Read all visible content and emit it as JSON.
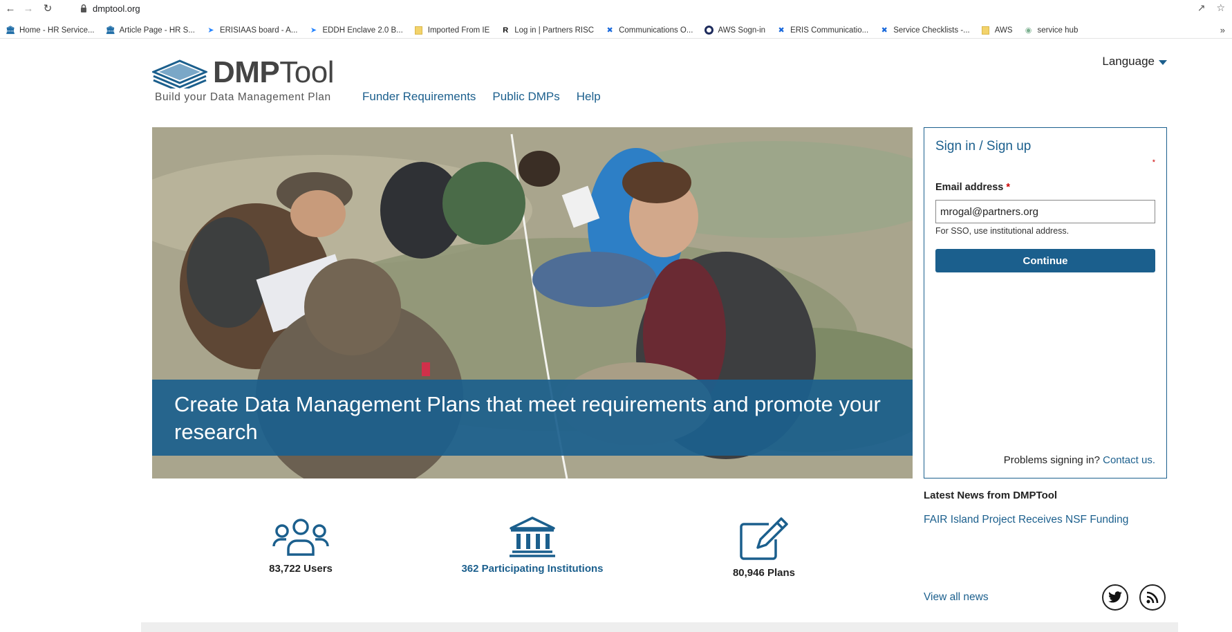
{
  "browser": {
    "url": "dmptool.org",
    "bookmarks": [
      {
        "label": "Home - HR Service...",
        "icon": "building-icon"
      },
      {
        "label": "Article Page - HR S...",
        "icon": "building-icon"
      },
      {
        "label": "ERISIAAS board - A...",
        "icon": "jira-icon"
      },
      {
        "label": "EDDH Enclave 2.0 B...",
        "icon": "jira-icon"
      },
      {
        "label": "Imported From IE",
        "icon": "folder-icon"
      },
      {
        "label": "Log in | Partners RISC",
        "icon": "r-icon"
      },
      {
        "label": "Communications O...",
        "icon": "confluence-icon"
      },
      {
        "label": "AWS Sogn-in",
        "icon": "circle-icon"
      },
      {
        "label": "ERIS Communicatio...",
        "icon": "confluence-icon"
      },
      {
        "label": "Service Checklists -...",
        "icon": "confluence-icon"
      },
      {
        "label": "AWS",
        "icon": "folder-icon"
      },
      {
        "label": "service hub",
        "icon": "globe-icon"
      }
    ],
    "more": "»"
  },
  "header": {
    "logo_bold": "DMP",
    "logo_light": "Tool",
    "tagline": "Build your Data Management Plan",
    "nav": [
      "Funder Requirements",
      "Public DMPs",
      "Help"
    ],
    "language": "Language"
  },
  "hero": {
    "caption": "Create Data Management Plans that meet requirements and promote your research"
  },
  "signin": {
    "title": "Sign in / Sign up",
    "required_marker": "*",
    "email_label": "Email address",
    "email_value": "mrogal@partners.org",
    "hint": "For SSO, use institutional address.",
    "continue": "Continue",
    "problems_text": "Problems signing in?",
    "contact": "Contact us."
  },
  "stats": {
    "users": "83,722 Users",
    "institutions": "362 Participating Institutions",
    "plans": "80,946 Plans"
  },
  "news": {
    "title": "Latest News from DMPTool",
    "item": "FAIR Island Project Receives NSF Funding",
    "view_all": "View all news"
  },
  "colors": {
    "brand_blue": "#1b5f8d",
    "required_red": "#cc0000"
  }
}
